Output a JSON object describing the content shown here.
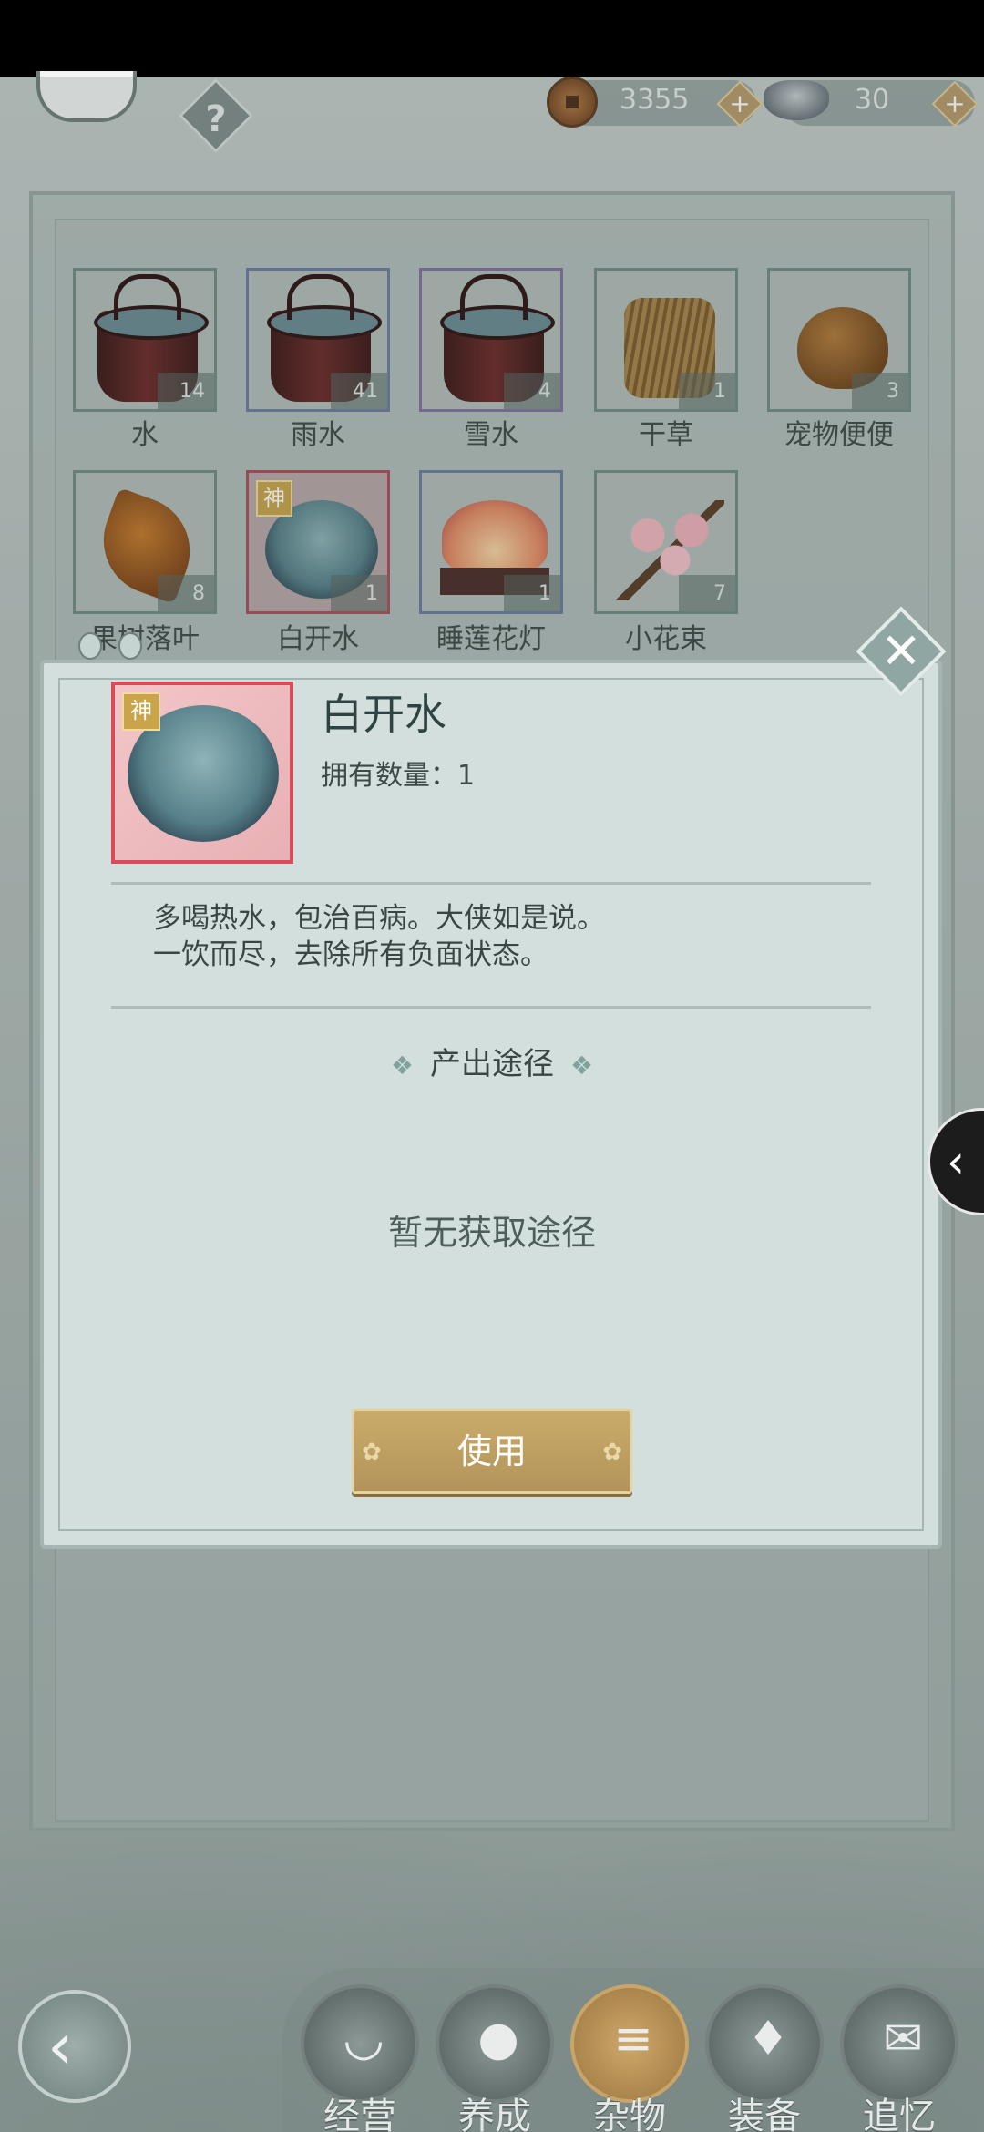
{
  "currency": {
    "coins": "3355",
    "ingots": "30",
    "add_symbol": "+"
  },
  "help": {
    "label": "?"
  },
  "inventory": {
    "items": [
      {
        "name": "水",
        "count": "14",
        "icon": "water-bucket"
      },
      {
        "name": "雨水",
        "count": "41",
        "icon": "rainwater-bucket"
      },
      {
        "name": "雪水",
        "count": "4",
        "icon": "snowwater-bucket"
      },
      {
        "name": "干草",
        "count": "1",
        "icon": "hay-bundle"
      },
      {
        "name": "宠物便便",
        "count": "3",
        "icon": "pet-poop"
      },
      {
        "name": "果树落叶",
        "count": "8",
        "icon": "fallen-leaf"
      },
      {
        "name": "白开水",
        "count": "1",
        "icon": "water-bowl",
        "badge": "神"
      },
      {
        "name": "睡莲花灯",
        "count": "1",
        "icon": "lotus-lantern"
      },
      {
        "name": "小花束",
        "count": "7",
        "icon": "flower-bouquet"
      }
    ]
  },
  "detail": {
    "badge": "神",
    "title": "白开水",
    "owned_label": "拥有数量：",
    "owned_value": "1",
    "description": [
      "多喝热水，包治百病。大侠如是说。",
      "一饮而尽，去除所有负面状态。"
    ],
    "source_heading": "产出途径",
    "source_empty": "暂无获取途径",
    "use_button": "使用",
    "close_symbol": "✕",
    "ornament": "❖"
  },
  "side_tab": {
    "symbol": "‹"
  },
  "back": {
    "symbol": "‹"
  },
  "nav": {
    "items": [
      {
        "label": "经营",
        "icon": "bowl-icon"
      },
      {
        "label": "养成",
        "icon": "orb-icon"
      },
      {
        "label": "杂物",
        "icon": "bundle-icon",
        "active": true
      },
      {
        "label": "装备",
        "icon": "robe-icon"
      },
      {
        "label": "追忆",
        "icon": "envelope-icon"
      }
    ]
  }
}
